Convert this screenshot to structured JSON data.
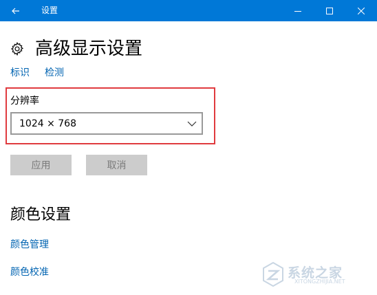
{
  "window": {
    "title": "设置",
    "icons": {
      "back": "back-arrow-icon",
      "minimize": "minimize-icon",
      "maximize": "maximize-icon",
      "close": "close-icon"
    }
  },
  "page": {
    "title": "高级显示设置",
    "icon": "gear-icon",
    "links": {
      "identify": "标识",
      "detect": "检测"
    }
  },
  "resolution": {
    "label": "分辨率",
    "value": "1024 × 768"
  },
  "buttons": {
    "apply": "应用",
    "cancel": "取消"
  },
  "color_settings": {
    "heading": "颜色设置",
    "links": {
      "management": "颜色管理",
      "calibration": "颜色校准"
    }
  },
  "watermark": {
    "text": "系统之家",
    "url": "XITONGZHIJIA.NET"
  },
  "colors": {
    "titlebar": "#0078d7",
    "link": "#0063b1",
    "highlight": "#e03a3e",
    "button_bg": "#cccccc"
  }
}
